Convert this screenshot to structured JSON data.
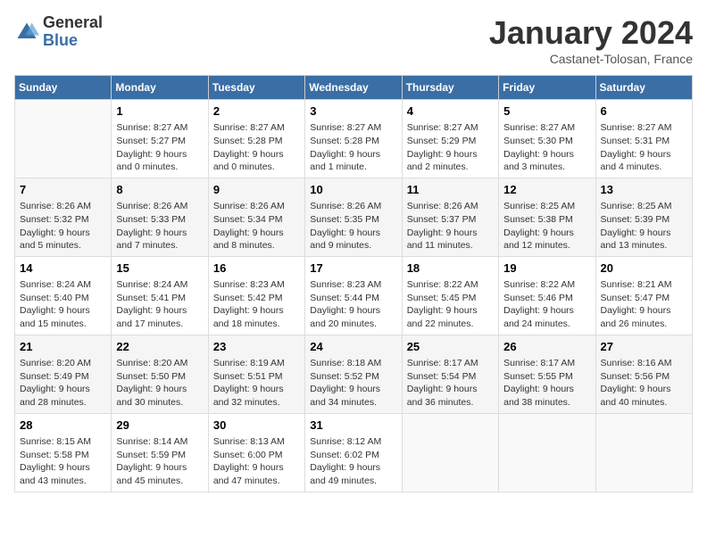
{
  "header": {
    "logo_general": "General",
    "logo_blue": "Blue",
    "month_title": "January 2024",
    "location": "Castanet-Tolosan, France"
  },
  "weekdays": [
    "Sunday",
    "Monday",
    "Tuesday",
    "Wednesday",
    "Thursday",
    "Friday",
    "Saturday"
  ],
  "weeks": [
    [
      {
        "day": "",
        "info": ""
      },
      {
        "day": "1",
        "info": "Sunrise: 8:27 AM\nSunset: 5:27 PM\nDaylight: 9 hours\nand 0 minutes."
      },
      {
        "day": "2",
        "info": "Sunrise: 8:27 AM\nSunset: 5:28 PM\nDaylight: 9 hours\nand 0 minutes."
      },
      {
        "day": "3",
        "info": "Sunrise: 8:27 AM\nSunset: 5:28 PM\nDaylight: 9 hours\nand 1 minute."
      },
      {
        "day": "4",
        "info": "Sunrise: 8:27 AM\nSunset: 5:29 PM\nDaylight: 9 hours\nand 2 minutes."
      },
      {
        "day": "5",
        "info": "Sunrise: 8:27 AM\nSunset: 5:30 PM\nDaylight: 9 hours\nand 3 minutes."
      },
      {
        "day": "6",
        "info": "Sunrise: 8:27 AM\nSunset: 5:31 PM\nDaylight: 9 hours\nand 4 minutes."
      }
    ],
    [
      {
        "day": "7",
        "info": "Sunrise: 8:26 AM\nSunset: 5:32 PM\nDaylight: 9 hours\nand 5 minutes."
      },
      {
        "day": "8",
        "info": "Sunrise: 8:26 AM\nSunset: 5:33 PM\nDaylight: 9 hours\nand 7 minutes."
      },
      {
        "day": "9",
        "info": "Sunrise: 8:26 AM\nSunset: 5:34 PM\nDaylight: 9 hours\nand 8 minutes."
      },
      {
        "day": "10",
        "info": "Sunrise: 8:26 AM\nSunset: 5:35 PM\nDaylight: 9 hours\nand 9 minutes."
      },
      {
        "day": "11",
        "info": "Sunrise: 8:26 AM\nSunset: 5:37 PM\nDaylight: 9 hours\nand 11 minutes."
      },
      {
        "day": "12",
        "info": "Sunrise: 8:25 AM\nSunset: 5:38 PM\nDaylight: 9 hours\nand 12 minutes."
      },
      {
        "day": "13",
        "info": "Sunrise: 8:25 AM\nSunset: 5:39 PM\nDaylight: 9 hours\nand 13 minutes."
      }
    ],
    [
      {
        "day": "14",
        "info": "Sunrise: 8:24 AM\nSunset: 5:40 PM\nDaylight: 9 hours\nand 15 minutes."
      },
      {
        "day": "15",
        "info": "Sunrise: 8:24 AM\nSunset: 5:41 PM\nDaylight: 9 hours\nand 17 minutes."
      },
      {
        "day": "16",
        "info": "Sunrise: 8:23 AM\nSunset: 5:42 PM\nDaylight: 9 hours\nand 18 minutes."
      },
      {
        "day": "17",
        "info": "Sunrise: 8:23 AM\nSunset: 5:44 PM\nDaylight: 9 hours\nand 20 minutes."
      },
      {
        "day": "18",
        "info": "Sunrise: 8:22 AM\nSunset: 5:45 PM\nDaylight: 9 hours\nand 22 minutes."
      },
      {
        "day": "19",
        "info": "Sunrise: 8:22 AM\nSunset: 5:46 PM\nDaylight: 9 hours\nand 24 minutes."
      },
      {
        "day": "20",
        "info": "Sunrise: 8:21 AM\nSunset: 5:47 PM\nDaylight: 9 hours\nand 26 minutes."
      }
    ],
    [
      {
        "day": "21",
        "info": "Sunrise: 8:20 AM\nSunset: 5:49 PM\nDaylight: 9 hours\nand 28 minutes."
      },
      {
        "day": "22",
        "info": "Sunrise: 8:20 AM\nSunset: 5:50 PM\nDaylight: 9 hours\nand 30 minutes."
      },
      {
        "day": "23",
        "info": "Sunrise: 8:19 AM\nSunset: 5:51 PM\nDaylight: 9 hours\nand 32 minutes."
      },
      {
        "day": "24",
        "info": "Sunrise: 8:18 AM\nSunset: 5:52 PM\nDaylight: 9 hours\nand 34 minutes."
      },
      {
        "day": "25",
        "info": "Sunrise: 8:17 AM\nSunset: 5:54 PM\nDaylight: 9 hours\nand 36 minutes."
      },
      {
        "day": "26",
        "info": "Sunrise: 8:17 AM\nSunset: 5:55 PM\nDaylight: 9 hours\nand 38 minutes."
      },
      {
        "day": "27",
        "info": "Sunrise: 8:16 AM\nSunset: 5:56 PM\nDaylight: 9 hours\nand 40 minutes."
      }
    ],
    [
      {
        "day": "28",
        "info": "Sunrise: 8:15 AM\nSunset: 5:58 PM\nDaylight: 9 hours\nand 43 minutes."
      },
      {
        "day": "29",
        "info": "Sunrise: 8:14 AM\nSunset: 5:59 PM\nDaylight: 9 hours\nand 45 minutes."
      },
      {
        "day": "30",
        "info": "Sunrise: 8:13 AM\nSunset: 6:00 PM\nDaylight: 9 hours\nand 47 minutes."
      },
      {
        "day": "31",
        "info": "Sunrise: 8:12 AM\nSunset: 6:02 PM\nDaylight: 9 hours\nand 49 minutes."
      },
      {
        "day": "",
        "info": ""
      },
      {
        "day": "",
        "info": ""
      },
      {
        "day": "",
        "info": ""
      }
    ]
  ]
}
